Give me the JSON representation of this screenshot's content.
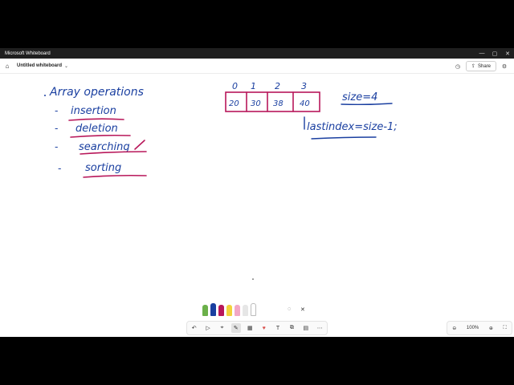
{
  "window": {
    "title": "Microsoft Whiteboard",
    "minimize": "—",
    "maximize": "▢",
    "close": "✕"
  },
  "appbar": {
    "board_name": "Untitled whiteboard",
    "share_label": "Share"
  },
  "canvas": {
    "heading": "Array operations",
    "ops": [
      "insertion",
      "deletion",
      "searching",
      "sorting"
    ],
    "indices": [
      "0",
      "1",
      "2",
      "3"
    ],
    "cells": [
      "20",
      "30",
      "38",
      "40"
    ],
    "size_note": "size=4",
    "last_index_note": "lastindex=size-1;"
  },
  "toolbar": {
    "undo": "↶",
    "select": "▷",
    "lasso": "⌖",
    "pen": "✎",
    "sticky": "▦",
    "reactions": "♥",
    "text": "T",
    "shapes": "⧉",
    "more": "▤",
    "overflow": "⋯"
  },
  "zoom": {
    "out": "⊖",
    "level": "100%",
    "in": "⊕",
    "fit": "⛶"
  },
  "colors": {
    "ink_blue": "#1a3fa0",
    "ink_magenta": "#b8175a",
    "accent": "#0067c0"
  }
}
